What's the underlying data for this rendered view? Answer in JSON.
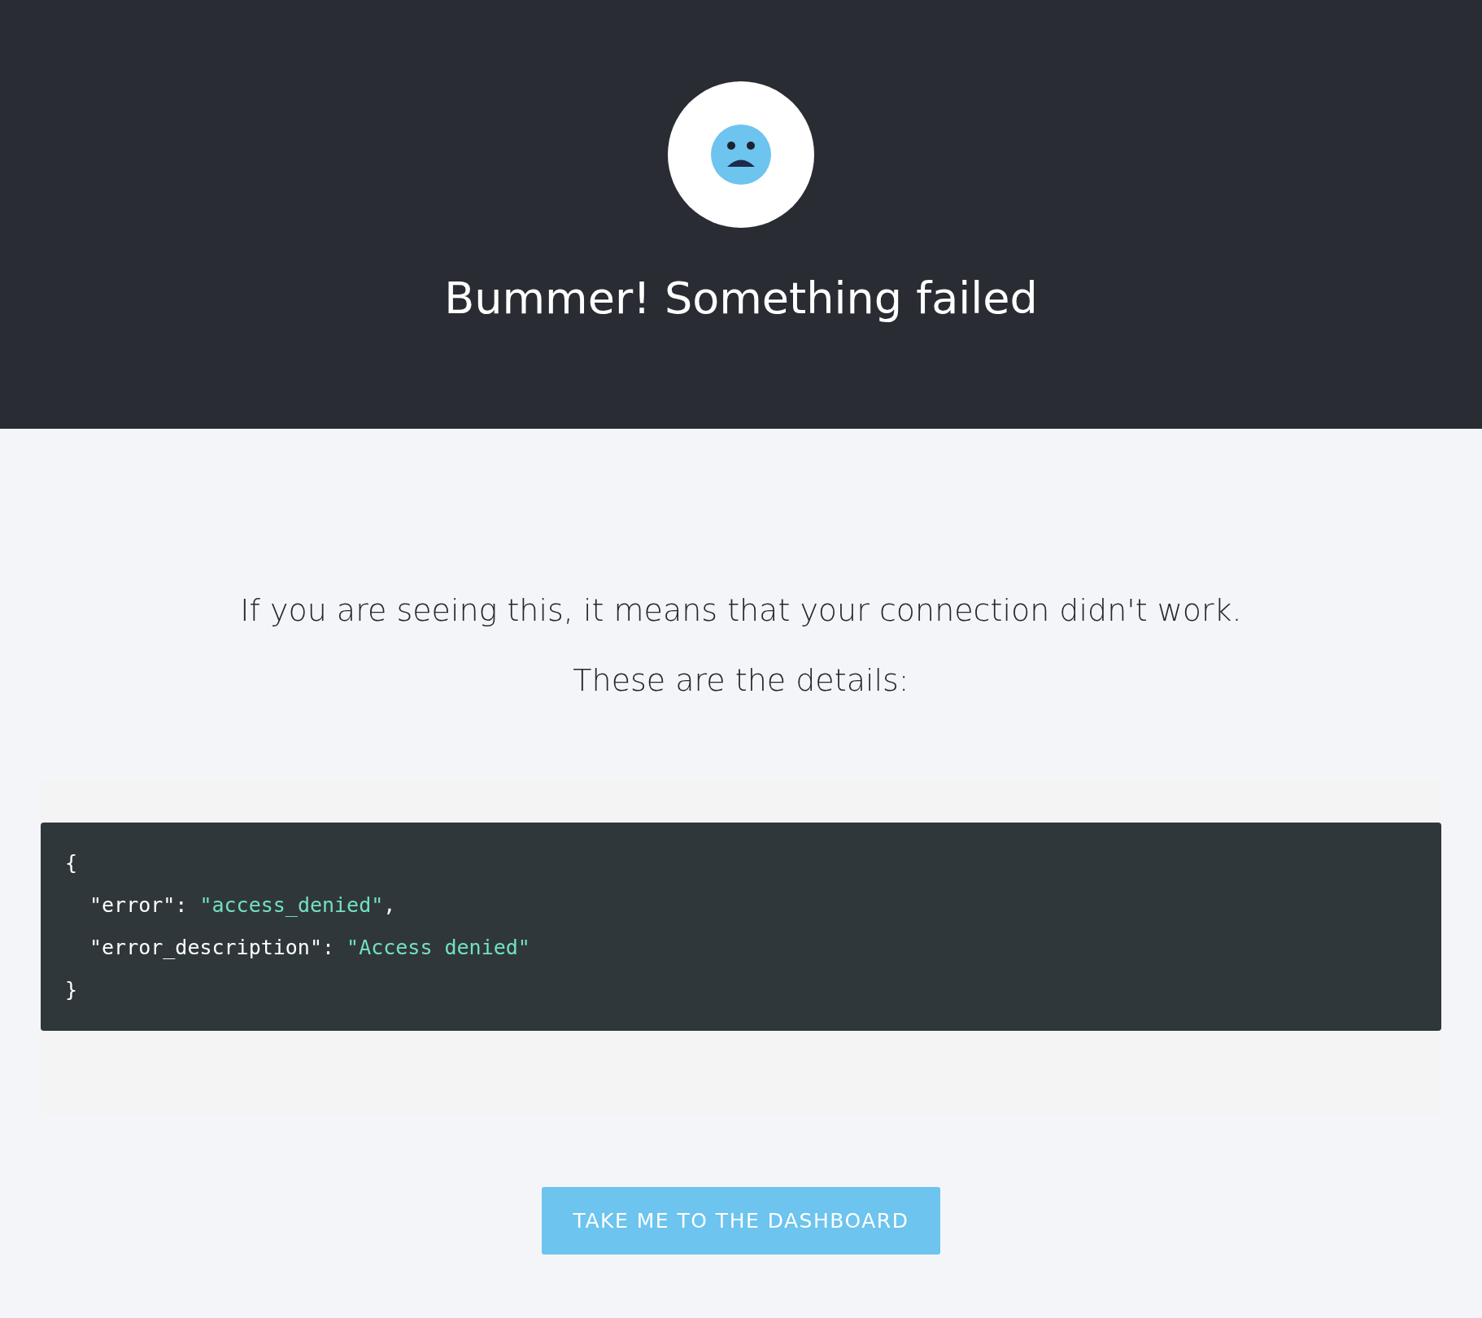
{
  "header": {
    "title": "Bummer! Something failed"
  },
  "message": [
    "If you are seeing this, it means that your connection didn't work.",
    "These are the details:"
  ],
  "code": [
    {
      "indented": false,
      "tokens": [
        {
          "kind": "plain",
          "text": "{"
        }
      ]
    },
    {
      "indented": true,
      "tokens": [
        {
          "kind": "plain",
          "text": "\"error\": "
        },
        {
          "kind": "string",
          "text": "\"access_denied\""
        },
        {
          "kind": "plain",
          "text": ","
        }
      ]
    },
    {
      "indented": true,
      "tokens": [
        {
          "kind": "plain",
          "text": "\"error_description\": "
        },
        {
          "kind": "string",
          "text": "\"Access denied\""
        }
      ]
    },
    {
      "indented": false,
      "tokens": [
        {
          "kind": "plain",
          "text": "}"
        }
      ]
    }
  ],
  "button": {
    "label": "TAKE ME TO THE DASHBOARD"
  }
}
